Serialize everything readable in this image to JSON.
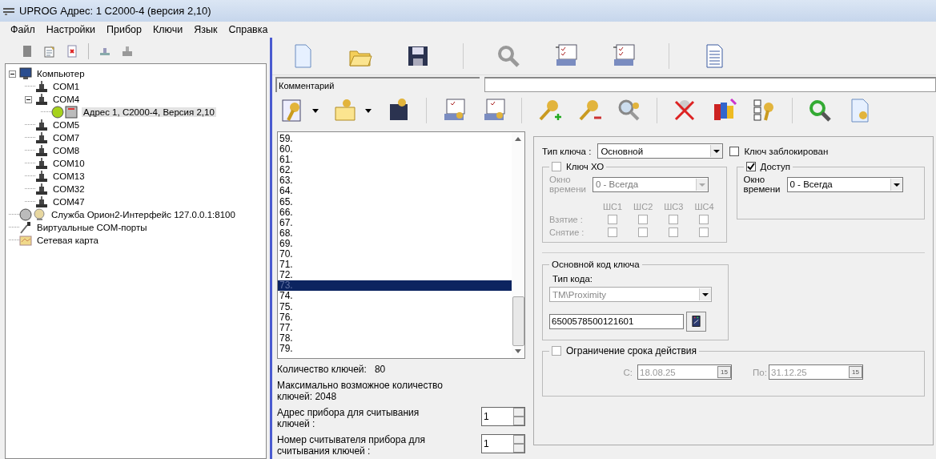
{
  "window": {
    "title": "UPROG  Адрес:  1  С2000-4 (версия  2,10)"
  },
  "menu": [
    "Файл",
    "Настройки",
    "Прибор",
    "Ключи",
    "Язык",
    "Справка"
  ],
  "tree": [
    {
      "label": "Компьютер",
      "kind": "computer",
      "expanded": true,
      "selected": false,
      "children": [
        {
          "label": "COM1",
          "kind": "port",
          "selected": false
        },
        {
          "label": "COM4",
          "kind": "port",
          "expanded": true,
          "selected": false,
          "children": [
            {
              "label": "Адрес 1, С2000-4, Версия 2,10",
              "kind": "device",
              "selected": true
            }
          ]
        },
        {
          "label": "COM5",
          "kind": "port",
          "selected": false
        },
        {
          "label": "COM7",
          "kind": "port",
          "selected": false
        },
        {
          "label": "COM8",
          "kind": "port",
          "selected": false
        },
        {
          "label": "COM10",
          "kind": "port",
          "selected": false
        },
        {
          "label": "COM13",
          "kind": "port",
          "selected": false
        },
        {
          "label": "COM32",
          "kind": "port",
          "selected": false
        },
        {
          "label": "COM47",
          "kind": "port",
          "selected": false
        }
      ]
    },
    {
      "label": "Служба Орион2-Интерфейс 127.0.0.1:8100",
      "kind": "service",
      "selected": false
    },
    {
      "label": "Виртуальные COM-порты",
      "kind": "virtual",
      "selected": false
    },
    {
      "label": "Сетевая карта",
      "kind": "map",
      "selected": false
    }
  ],
  "comment": {
    "label": "Комментарий"
  },
  "keys_list": [
    {
      "label": "59.",
      "selected": false
    },
    {
      "label": "60.",
      "selected": false
    },
    {
      "label": "61.",
      "selected": false
    },
    {
      "label": "62.",
      "selected": false
    },
    {
      "label": "63.",
      "selected": false
    },
    {
      "label": "64.",
      "selected": false
    },
    {
      "label": "65.",
      "selected": false
    },
    {
      "label": "66.",
      "selected": false
    },
    {
      "label": "67.",
      "selected": false
    },
    {
      "label": "68.",
      "selected": false
    },
    {
      "label": "69.",
      "selected": false
    },
    {
      "label": "70.",
      "selected": false
    },
    {
      "label": "71.",
      "selected": false
    },
    {
      "label": "72.",
      "selected": false
    },
    {
      "label": "73.",
      "selected": true
    },
    {
      "label": "74.",
      "selected": false
    },
    {
      "label": "75.",
      "selected": false
    },
    {
      "label": "76.",
      "selected": false
    },
    {
      "label": "77.",
      "selected": false
    },
    {
      "label": "78.",
      "selected": false
    },
    {
      "label": "79.",
      "selected": false
    }
  ],
  "key_count": {
    "label": "Количество ключей:",
    "value": "80"
  },
  "max_count": "Максимально возможное количество ключей:  2048",
  "spinners": [
    {
      "label": "Адрес прибора для считывания ключей :",
      "value": "1"
    },
    {
      "label": "Номер считывателя прибора для считывания ключей :",
      "value": "1"
    }
  ],
  "key_type": {
    "label": "Тип ключа :",
    "value": "Основной"
  },
  "blocked": {
    "label": "Ключ заблокирован",
    "checked": false
  },
  "xo": {
    "label": "Ключ ХО",
    "checked": false,
    "window_label": "Окно времени",
    "window_value": "0 - Всегда",
    "columns": [
      "ШС1",
      "ШС2",
      "ШС3",
      "ШС4"
    ],
    "rows": [
      {
        "label": "Взятие :",
        "checks": [
          false,
          false,
          false,
          false
        ]
      },
      {
        "label": "Снятие :",
        "checks": [
          false,
          false,
          false,
          false
        ]
      }
    ]
  },
  "access": {
    "label": "Доступ",
    "checked": true,
    "window_label": "Окно времени",
    "window_value": "0 - Всегда"
  },
  "code": {
    "title": "Основной код ключа",
    "type_label": "Тип кода:",
    "type_value": "TM\\Proximity",
    "type_disabled": true,
    "value": "6500578500121601"
  },
  "validity": {
    "label": "Ограничение срока действия",
    "checked": false,
    "from_label": "С:",
    "from": "18.08.25",
    "to_label": "По:",
    "to": "31.12.25",
    "from_calendar_glyph": "15",
    "to_calendar_glyph": "15"
  }
}
